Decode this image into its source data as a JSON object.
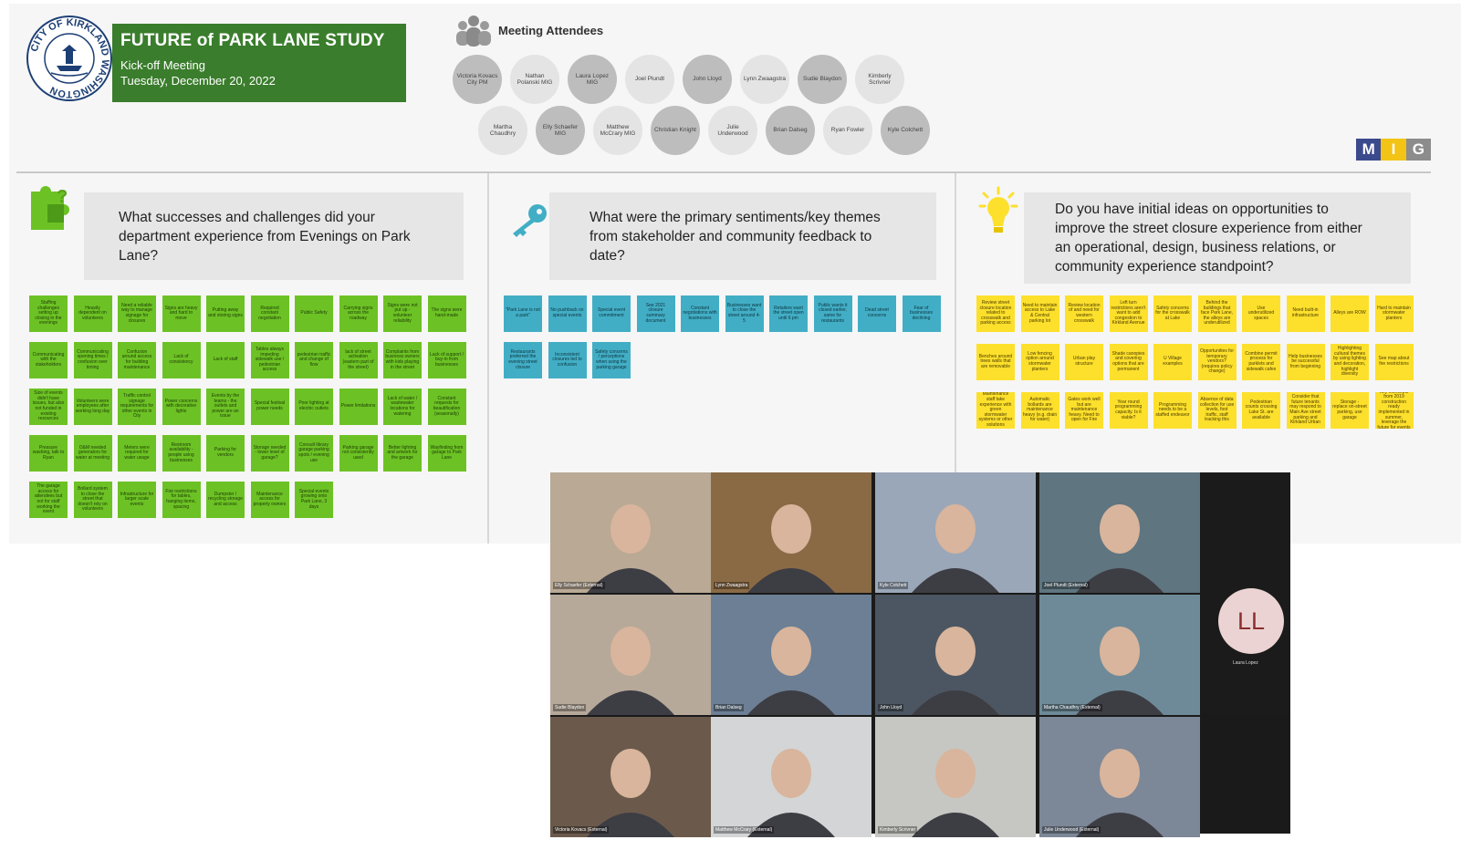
{
  "header": {
    "title": "FUTURE of PARK LANE STUDY",
    "subtitle": "Kick-off Meeting",
    "date": "Tuesday, December 20, 2022",
    "seal_text": "CITY OF KIRKLAND WASHINGTON",
    "attendees_title": "Meeting Attendees",
    "logo": [
      "M",
      "I",
      "G"
    ]
  },
  "attendees": [
    {
      "name": "Victoria Kovacs City PM",
      "shade": "dark"
    },
    {
      "name": "Nathan Polanski MIG",
      "shade": "light"
    },
    {
      "name": "Laura Lopez MIG",
      "shade": "dark"
    },
    {
      "name": "Joel Plundt",
      "shade": "light"
    },
    {
      "name": "John Lloyd",
      "shade": "dark"
    },
    {
      "name": "Lynn Zwaagstra",
      "shade": "light"
    },
    {
      "name": "Sudie Blaydon",
      "shade": "dark"
    },
    {
      "name": "Kimberly Scrivner",
      "shade": "light"
    },
    {
      "name": "Martha Chaudhry",
      "shade": "light"
    },
    {
      "name": "Elly Schaefer MIG",
      "shade": "dark"
    },
    {
      "name": "Matthew McCrary MIG",
      "shade": "light"
    },
    {
      "name": "Christian Knight",
      "shade": "dark"
    },
    {
      "name": "Julie Underwood",
      "shade": "light"
    },
    {
      "name": "Brian Dalseg",
      "shade": "dark"
    },
    {
      "name": "Ryan Fowler",
      "shade": "light"
    },
    {
      "name": "Kyle Colchett",
      "shade": "dark"
    }
  ],
  "questions": [
    {
      "text": "What successes and challenges did your department experience from Evenings on Park Lane?",
      "icon": "puzzle-icon"
    },
    {
      "text": "What were the primary sentiments/key themes from stakeholder and community feedback to date?",
      "icon": "key-icon"
    },
    {
      "text": "Do you have initial ideas on opportunities to improve the street closure experience from either an operational, design, business relations, or community experience standpoint?",
      "icon": "lightbulb-icon"
    }
  ],
  "notes": {
    "green": [
      "Staffing challenges setting up closing in the evenings",
      "Heavily dependent on volunteers",
      "Need a reliable way to manage signage for closures",
      "Signs are heavy and hard to move",
      "Putting away and storing signs",
      "Required constant negotiation",
      "Public Safety",
      "Carrying signs across the roadway",
      "Signs were not put up - volunteer reliability",
      "The signs were hand-made",
      "Communicating with the stakeholders",
      "Communicating opening times / confusion over timing",
      "Confusion around access for building maintenance",
      "Lack of consistency",
      "Lack of staff",
      "Tables always impeding sidewalk use / pedestrian access",
      "pedestrian traffic and change of flow",
      "lack of street activation (eastern part of the street)",
      "Complaints from business owners with kids playing in the street",
      "Lack of support / buy-in from businesses",
      "Size of events didn't have issues, but also not funded in existing resources",
      "Volunteers were employees after working long day",
      "Traffic control signage requirements for other events in City",
      "Power concerns with decorative lights",
      "Events by the teams - the outlets and power are an issue",
      "Special festival power needs",
      "Poor lighting at electric outlets",
      "Power limitations",
      "Lack of water / wastewater locations for watering",
      "Constant requests for beautification (seasonally)",
      "Pressure washing, talk to Ryan",
      "O&M needed generators for water at meeting",
      "Meters were required for water usage",
      "Restroom availability - people using businesses",
      "Parking for vendors",
      "Storage needed - lower level of garage?",
      "Consult library garage parking spots / evening use",
      "Parking garage not consistently used",
      "Better lighting and artwork for the garage",
      "Wayfinding from garage to Park Lane",
      "The garage access for attendees but not for staff working the event",
      "Bollard system to close the street that doesn't rely on volunteers",
      "Infrastructure for larger scale events",
      "Fire restrictions for tables, hanging items, spacing",
      "Dumpster / recycling storage and access",
      "Maintenance access for property owners",
      "Special events growing onto Park Lane, 3 days"
    ],
    "blue": [
      "\"Park Lane is not a park\"",
      "No pushback on special events",
      "Special event commitment",
      "See 2021 closure summary document",
      "Constant negotiations with businesses",
      "Businesses want to close the street around 4-5",
      "Retailers want the street open until 6 pm",
      "Public wants it closed earlier, same for restaurants",
      "Dead street concerns",
      "Fear of businesses declining",
      "Restaurants preferred the evening street closure",
      "Inconsistent closures led to confusion",
      "Safety concerns / perceptions when using the parking garage"
    ],
    "yellow": [
      "Review street closure location related to crosswalk and parking access",
      "Need to maintain access to Lake & Central parking lot",
      "Review location of and need for western crosswalk",
      "Left turn restrictions aren't want to add congestion to Kirkland Avenue",
      "Safety concerns for the crosswalk at Lake",
      "Behind the buildings that face Park Lane, the alleys are underutilized",
      "Use underutilized spaces",
      "Need built-in infrastructure",
      "Alleys are ROW",
      "Hard to maintain stormwater planters",
      "Benches around trees walls that are removable",
      "Low fencing option around stormwater planters",
      "Urban play structure",
      "Shade canopies and covering options that are permanent",
      "U Village examples",
      "Opportunities for temporary vendors? (requires policy change)",
      "Combine permit process for parklets and sidewalk cafes",
      "Help businesses be successful from beginning",
      "Highlighting cultural themes by using lighting and decoration, highlight diversity",
      "See map about fire restrictions",
      "Maintenance staff take experience with green stormwater systems or other solutions",
      "Automatic bollards are maintenance heavy (e.g. drain for water)",
      "Gates work well but are maintenance heavy. Need to open for Fire",
      "Year round programming capacity. Is it viable?",
      "Programming needs to be a staffed endeavor",
      "Absence of data collection for use levels, foot traffic, staff tracking this",
      "Pedestrian counts crossing Lake St. are available",
      "Consider that future tenants may respond to Main Ave street parking and Kirkland Urban",
      "Storage - replace on-street parking, use garage",
      "Key intercepts from 2019 construction ready implemented in summer, leverage the future for events"
    ]
  },
  "video_call": {
    "participants": [
      {
        "name": "Elly Schaefer (External)",
        "bg": "#b9a995"
      },
      {
        "name": "Lynn Zwaagstra",
        "bg": "#8a6a45"
      },
      {
        "name": "Kyle Colchett",
        "bg": "#9aa7b8"
      },
      {
        "name": "Joel Plundt (External)",
        "bg": "#5f7580"
      },
      {
        "name": "Sudie Blaydon",
        "bg": "#b7a99a"
      },
      {
        "name": "Brian Dalseg",
        "bg": "#6c7f94"
      },
      {
        "name": "John Lloyd",
        "bg": "#4c5662"
      },
      {
        "name": "Martha Chaudhry (External)",
        "bg": "#6e8a98"
      },
      {
        "name": "Victoria Kovacs (External)",
        "bg": "#6b5a4c"
      },
      {
        "name": "Matthew McCrary (External)",
        "bg": "#d3d5d6"
      },
      {
        "name": "Kimberly Scrivner",
        "bg": "#c6c7c2"
      },
      {
        "name": "Julie Underwood (External)",
        "bg": "#7c8797"
      }
    ],
    "avatar": {
      "initials": "LL",
      "name": "Laura Lopez"
    }
  }
}
